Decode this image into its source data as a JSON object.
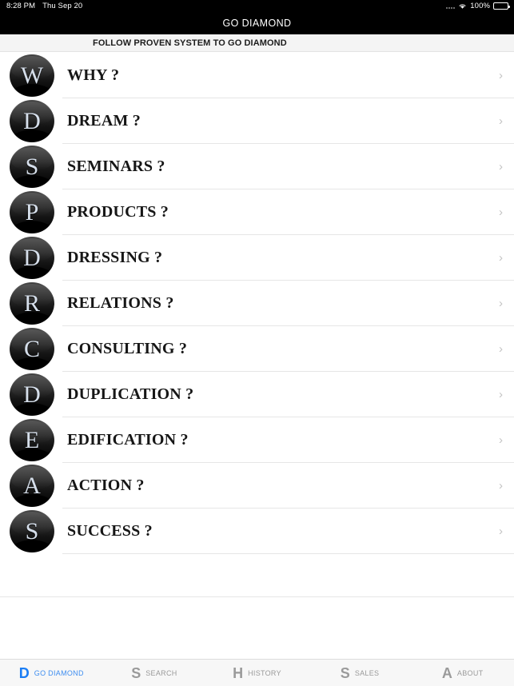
{
  "status_bar": {
    "time": "8:28 PM",
    "date": "Thu Sep 20",
    "battery_percent": "100%",
    "wifi_icon": "wifi-icon",
    "dots_icon": "signal-dots-icon",
    "battery_icon": "battery-icon"
  },
  "nav": {
    "title": "GO DIAMOND"
  },
  "section": {
    "header": "FOLLOW PROVEN SYSTEM TO GO DIAMOND"
  },
  "list": {
    "chevron_glyph": "›",
    "items": [
      {
        "badge": "W",
        "label": "WHY ?"
      },
      {
        "badge": "D",
        "label": "DREAM ?"
      },
      {
        "badge": "S",
        "label": "SEMINARS ?"
      },
      {
        "badge": "P",
        "label": "PRODUCTS ?"
      },
      {
        "badge": "D",
        "label": "DRESSING ?"
      },
      {
        "badge": "R",
        "label": "RELATIONS ?"
      },
      {
        "badge": "C",
        "label": "CONSULTING ?"
      },
      {
        "badge": "D",
        "label": "DUPLICATION ?"
      },
      {
        "badge": "E",
        "label": "EDIFICATION ?"
      },
      {
        "badge": "A",
        "label": "ACTION ?"
      },
      {
        "badge": "S",
        "label": "SUCCESS ?"
      }
    ]
  },
  "tab_bar": {
    "active_index": 0,
    "accent_color": "#1a7df5",
    "inactive_color": "#9a9a9a",
    "tabs": [
      {
        "icon": "D",
        "label": "GO DIAMOND",
        "name": "tab-go-diamond"
      },
      {
        "icon": "S",
        "label": "SEARCH",
        "name": "tab-search"
      },
      {
        "icon": "H",
        "label": "HISTORY",
        "name": "tab-history"
      },
      {
        "icon": "S",
        "label": "SALES",
        "name": "tab-sales"
      },
      {
        "icon": "A",
        "label": "ABOUT",
        "name": "tab-about"
      }
    ]
  }
}
